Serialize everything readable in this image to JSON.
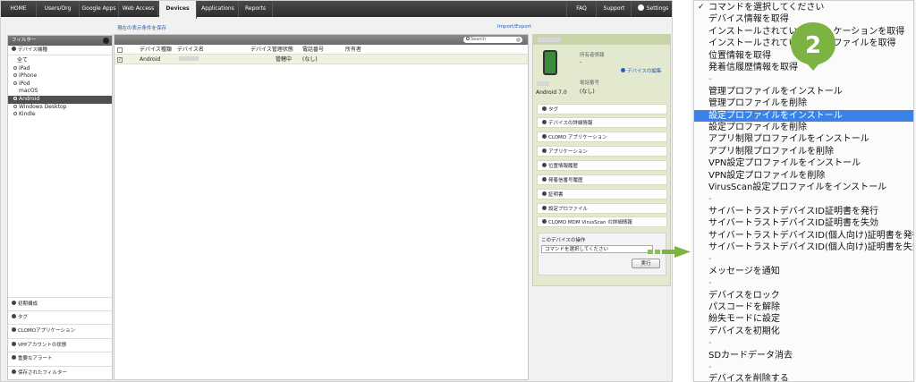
{
  "nav": {
    "tabs": [
      "HOME",
      "Users/Org",
      "Google Apps",
      "Web Access",
      "Devices",
      "Applications",
      "Reports"
    ],
    "active_tab": "Devices",
    "right": {
      "faq": "FAQ",
      "support": "Support",
      "settings": "Settings"
    }
  },
  "links": {
    "save_condition": "現在の表示条件を保存",
    "import_export": "Import/Export"
  },
  "sidebar": {
    "title": "フィルター",
    "device_model": "デバイス機種",
    "items": [
      "全て",
      "iPad",
      "iPhone",
      "iPod",
      "macOS",
      "Android",
      "Windows Desktop",
      "Kindle"
    ],
    "selected": "Android",
    "bottom": [
      "初期構成",
      "タグ",
      "CLOMOアプリケーション",
      "VPPアカウントの状態",
      "重要なアラート",
      "保存されたフィルター"
    ]
  },
  "table": {
    "search_placeholder": "Search",
    "headers": [
      "デバイス種類",
      "デバイス名",
      "デバイス管理状態",
      "電話番号",
      "所有者"
    ],
    "rows": [
      {
        "type": "Android",
        "status": "管轄中",
        "phone": "(なし)"
      }
    ],
    "row_checkmark": "✓"
  },
  "detail": {
    "owner_label": "所有者情報",
    "owner_value": "-",
    "edit_link": "デバイスの編集",
    "phone_label": "電話番号",
    "phone_value": "(なし)",
    "os_version": "Android 7.0",
    "sections": [
      "タグ",
      "デバイスの詳細情報",
      "CLOMO アプリケーション",
      "アプリケーション",
      "位置情報履歴",
      "発着信番号履歴",
      "証明書",
      "設定プロファイル",
      "CLOMO MDM VirusScan の詳細情報"
    ],
    "operations_title": "このデバイスの操作",
    "select_value": "コマンドを選択してください",
    "run_button": "実行"
  },
  "menu": {
    "check_mark": "✓",
    "items": [
      "コマンドを選択してください",
      "デバイス情報を取得",
      "インストールされてい　　　　ケーションを取得",
      "インストールされてい　　　　ファイルを取得",
      "位置情報を取得",
      "発着信履歴情報を取得",
      "-",
      "管理プロファイルをインストール",
      "管理プロファイルを削除",
      "設定プロファイルをインストール",
      "設定プロファイルを削除",
      "アプリ制限プロファイルをインストール",
      "アプリ制限プロファイルを削除",
      "VPN設定プロファイルをインストール",
      "VPN設定プロファイルを削除",
      "VirusScan設定プロファイルをインストール",
      "-",
      "サイバートラストデバイスID証明書を発行",
      "サイバートラストデバイスID証明書を失効",
      "サイバートラストデバイスID(個人向け)証明書を発行",
      "サイバートラストデバイスID(個人向け)証明書を失効",
      "-",
      "メッセージを通知",
      "-",
      "デバイスをロック",
      "パスコードを解除",
      "紛失モードに設定",
      "デバイスを初期化",
      "-",
      "SDカードデータ消去",
      "-",
      "デバイスを削除する"
    ],
    "highlighted": "設定プロファイルをインストール",
    "badge_number": "2"
  },
  "colors": {
    "accent_green": "#7cb342",
    "highlight_blue": "#3b82e6",
    "detail_bg": "#e2e9cf"
  }
}
